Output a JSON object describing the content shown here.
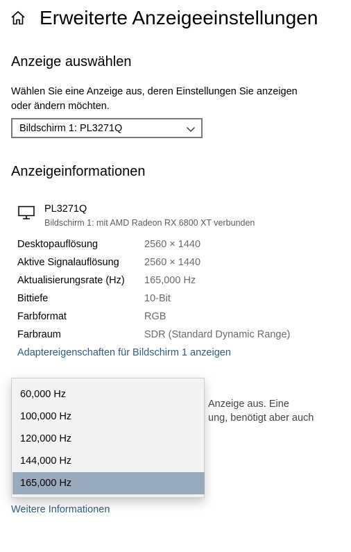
{
  "header": {
    "title": "Erweiterte Anzeigeeinstellungen",
    "home_icon": "home-icon"
  },
  "select_display": {
    "heading": "Anzeige auswählen",
    "description": "Wählen Sie eine Anzeige aus, deren Einstellungen Sie anzeigen oder ändern möchten.",
    "selected_value": "Bildschirm 1: PL3271Q",
    "chevron_icon": "chevron-down-icon"
  },
  "display_info": {
    "heading": "Anzeigeinformationen",
    "monitor_icon": "monitor-icon",
    "monitor_name": "PL3271Q",
    "monitor_subtitle": "Bildschirm 1: mit AMD Radeon RX 6800 XT verbunden",
    "rows": [
      {
        "label": "Desktopauflösung",
        "value": "2560 × 1440"
      },
      {
        "label": "Aktive Signalauflösung",
        "value": "2560 × 1440"
      },
      {
        "label": "Aktualisierungsrate (Hz)",
        "value": "165,000 Hz"
      },
      {
        "label": "Bittiefe",
        "value": "10-Bit"
      },
      {
        "label": "Farbformat",
        "value": "RGB"
      },
      {
        "label": "Farbraum",
        "value": "SDR (Standard Dynamic Range)"
      }
    ],
    "adapter_link": "Adaptereigenschaften für Bildschirm 1 anzeigen"
  },
  "background_text": {
    "line1": "Anzeige aus. Eine",
    "line2": "ung, benötigt aber auch"
  },
  "refresh_dropdown": {
    "options": [
      "60,000 Hz",
      "100,000 Hz",
      "120,000 Hz",
      "144,000 Hz",
      "165,000 Hz"
    ],
    "selected": "165,000 Hz"
  },
  "more_info_link": "Weitere Informationen",
  "colors": {
    "link": "#2e5d85",
    "selected_item_bg": "#9aaabd",
    "dropdown_bg": "#f2f2f2",
    "secondary_text": "#6b6b6b"
  }
}
